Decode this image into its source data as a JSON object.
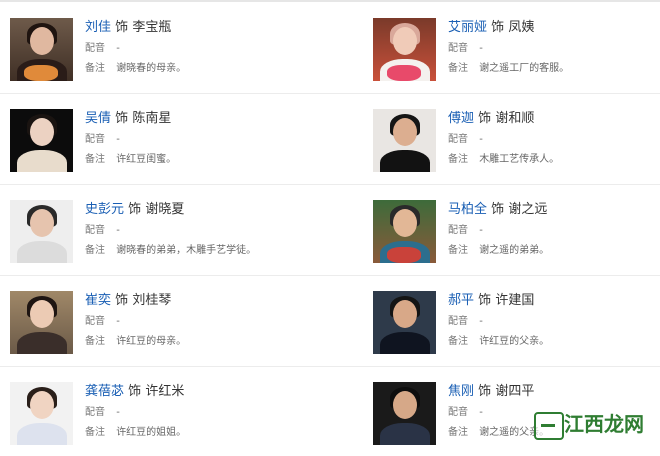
{
  "labels": {
    "as_word": "饰",
    "dubbing_label": "配音",
    "note_label": "备注"
  },
  "watermark_text": "江西龙网",
  "rows": [
    {
      "left": {
        "actor": "刘佳",
        "role": "李宝瓶",
        "dubbing": "-",
        "note": "谢晓春的母亲。"
      },
      "right": {
        "actor": "艾丽娅",
        "role": "凤姨",
        "dubbing": "-",
        "note": "谢之遥工厂的客服。"
      }
    },
    {
      "left": {
        "actor": "吴倩",
        "role": "陈南星",
        "dubbing": "-",
        "note": "许红豆闺蜜。"
      },
      "right": {
        "actor": "傅迦",
        "role": "谢和顺",
        "dubbing": "-",
        "note": "木雕工艺传承人。"
      }
    },
    {
      "left": {
        "actor": "史彭元",
        "role": "谢晓夏",
        "dubbing": "-",
        "note": "谢晓春的弟弟，木雕手艺学徒。"
      },
      "right": {
        "actor": "马柏全",
        "role": "谢之远",
        "dubbing": "-",
        "note": "谢之遥的弟弟。"
      }
    },
    {
      "left": {
        "actor": "崔奕",
        "role": "刘桂琴",
        "dubbing": "-",
        "note": "许红豆的母亲。"
      },
      "right": {
        "actor": "郝平",
        "role": "许建国",
        "dubbing": "-",
        "note": "许红豆的父亲。"
      }
    },
    {
      "left": {
        "actor": "龚蓓苾",
        "role": "许红米",
        "dubbing": "-",
        "note": "许红豆的姐姐。"
      },
      "right": {
        "actor": "焦刚",
        "role": "谢四平",
        "dubbing": "-",
        "note": "谢之遥的父亲。"
      }
    }
  ]
}
